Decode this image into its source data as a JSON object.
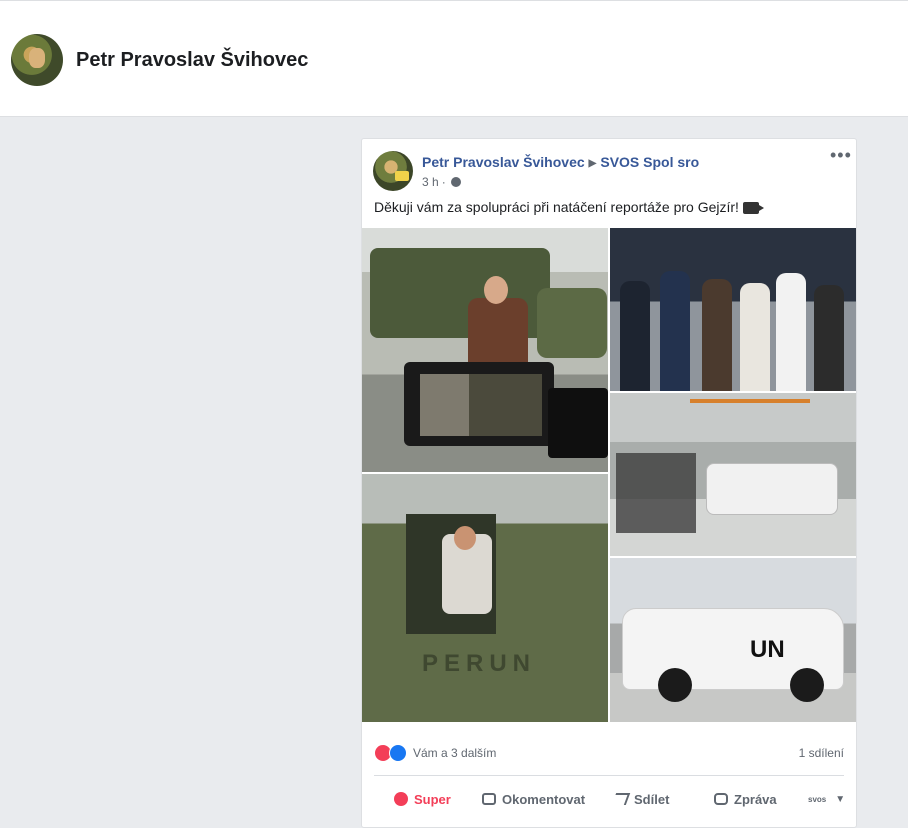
{
  "profile": {
    "name": "Petr Pravoslav Švihovec"
  },
  "post": {
    "author": "Petr Pravoslav Švihovec",
    "target": "SVOS Spol sro",
    "time": "3 h",
    "separator": "·",
    "text": "Děkuji vám za spolupráci při natáčení reportáže pro Gejzír!",
    "photo_labels": {
      "perun": "PERUN",
      "un": "UN"
    }
  },
  "reactions": {
    "summary": "Vám a 3 dalším",
    "shares": "1 sdílení"
  },
  "actions": {
    "super": "Super",
    "comment": "Okomentovat",
    "share": "Sdílet",
    "message": "Zpráva",
    "page_select": "svos"
  }
}
